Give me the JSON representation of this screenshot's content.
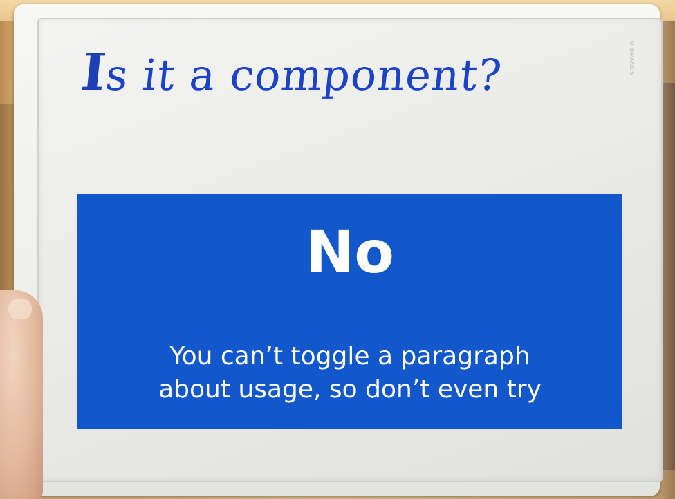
{
  "board": {
    "brand": "U BRANDS",
    "handwriting_cap": "I",
    "handwriting_rest": "s it a component?"
  },
  "callout": {
    "title": "No",
    "body_line1": "You can’t toggle a paragraph",
    "body_line2": "about usage, so don’t even try",
    "background_color": "#1357cc",
    "text_color": "#ffffff"
  },
  "colors": {
    "marker_ink": "#1b43c8",
    "board_white": "#f4f4f3"
  }
}
